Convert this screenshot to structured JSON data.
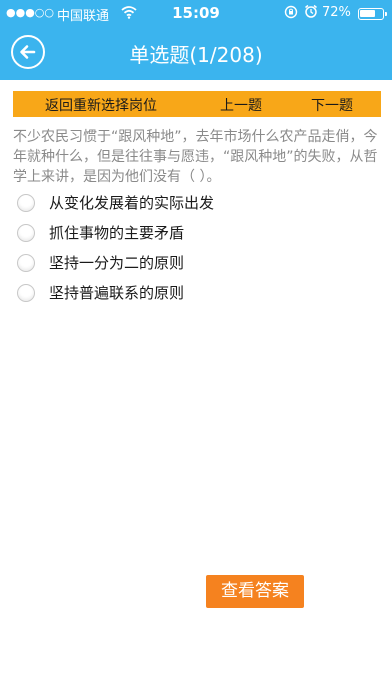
{
  "status_bar": {
    "signal": "●●●○○",
    "carrier": "中国联通",
    "time": "15:09",
    "battery_percent": "72%",
    "battery_level": 0.72,
    "icons": [
      "wifi-icon",
      "rotation-lock-icon",
      "alarm-icon",
      "battery-icon"
    ]
  },
  "nav": {
    "title": "单选题(1/208)",
    "back_icon": "back-arrow-icon"
  },
  "actions": {
    "reselect": "返回重新选择岗位",
    "prev": "上一题",
    "next": "下一题"
  },
  "question": {
    "text": "不少农民习惯于“跟风种地”，去年市场什么农产品走俏，今年就种什么，但是往往事与愿违，“跟风种地”的失败，从哲学上来讲，是因为他们没有（ ）。"
  },
  "options": [
    {
      "label": "从变化发展着的实际出发"
    },
    {
      "label": "抓住事物的主要矛盾"
    },
    {
      "label": "坚持一分为二的原则"
    },
    {
      "label": "坚持普遍联系的原则"
    }
  ],
  "answer_button": "查看答案",
  "colors": {
    "header": "#3bb4ee",
    "action_bar": "#f8a718",
    "answer_button": "#f5821f"
  }
}
